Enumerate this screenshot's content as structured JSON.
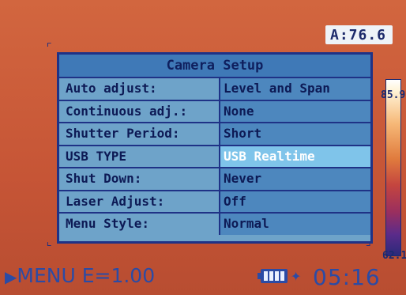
{
  "readout": {
    "text": "A:76.6"
  },
  "dialog": {
    "title": "Camera Setup",
    "rows": [
      {
        "label": "Auto adjust:",
        "value": "Level and Span",
        "selected": false
      },
      {
        "label": "Continuous adj.:",
        "value": "None",
        "selected": false
      },
      {
        "label": "Shutter Period:",
        "value": "Short",
        "selected": false
      },
      {
        "label": "USB TYPE",
        "value": "USB Realtime",
        "selected": true
      },
      {
        "label": "Shut Down:",
        "value": "Never",
        "selected": false
      },
      {
        "label": "Laser Adjust:",
        "value": "Off",
        "selected": false
      },
      {
        "label": "Menu Style:",
        "value": "Normal",
        "selected": false
      }
    ]
  },
  "scale": {
    "max_label": "85.9",
    "min_label": "62.1"
  },
  "status": {
    "menu_arrow": "▶",
    "menu_text": "MENU E=1.00",
    "battery_icon": "battery-icon",
    "laser_icon": "laser-pointer-icon",
    "time": "05:16"
  },
  "colors": {
    "background": "#c85a3a",
    "dialog_bg": "#6ea3c9",
    "dialog_border": "#1f3286",
    "title_bg": "#3f79b7",
    "selected_bg": "#7fc4ea",
    "status_text": "#2b4ba5"
  }
}
